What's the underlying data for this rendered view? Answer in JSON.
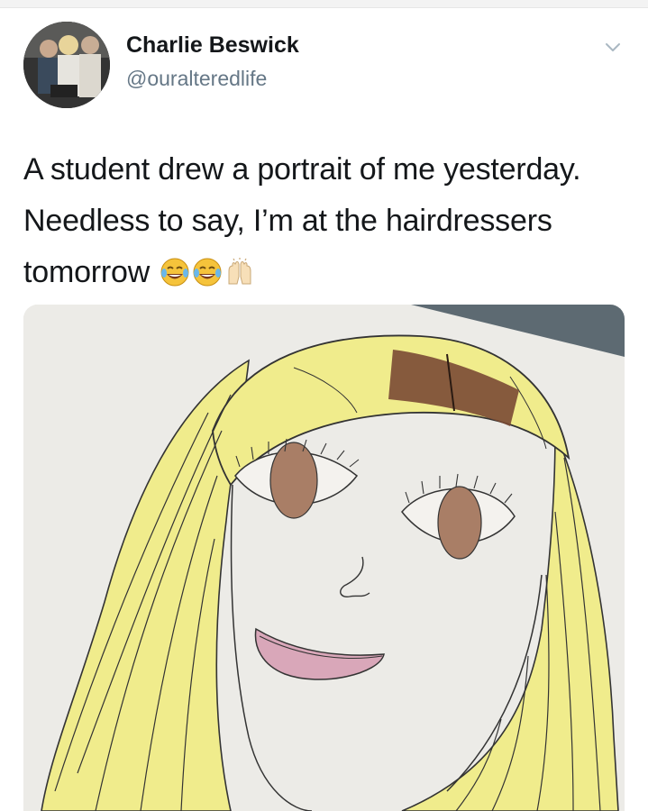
{
  "tweet": {
    "display_name": "Charlie Beswick",
    "handle": "@ouralteredlife",
    "text": "A student drew a portrait of me yesterday. Needless to say, I’m at the hairdressers tomorrow",
    "emojis": [
      "face-with-tears-of-joy-icon",
      "face-with-tears-of-joy-icon",
      "raising-hands-icon"
    ]
  },
  "icons": {
    "chevron": "chevron-down-icon"
  },
  "colors": {
    "name_text": "#14171a",
    "handle_text": "#657786",
    "hair_yellow": "#f0ec8c",
    "eyebrow_brown": "#7a4a34",
    "lip_pink": "#d9a7b9"
  }
}
